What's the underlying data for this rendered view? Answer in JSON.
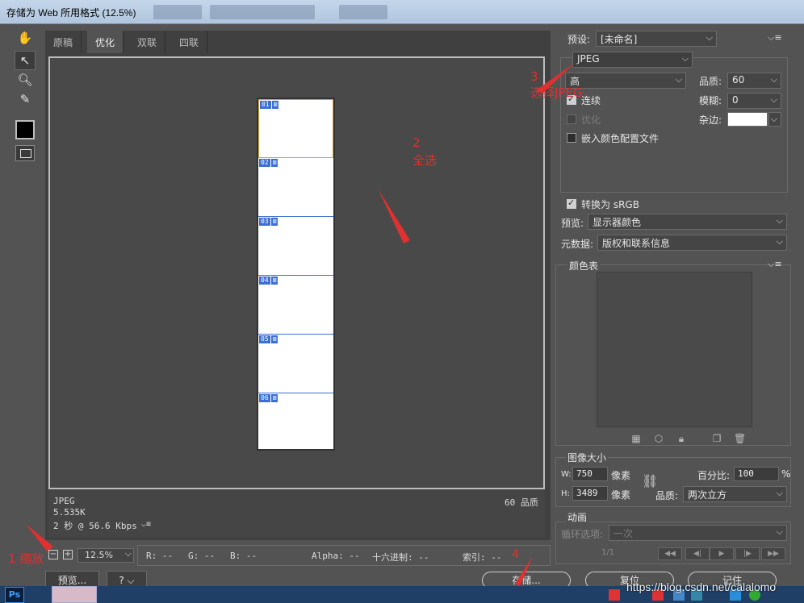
{
  "window": {
    "title": "存储为 Web 所用格式 (12.5%)"
  },
  "tabs": [
    "原稿",
    "优化",
    "双联",
    "四联"
  ],
  "active_tab": "优化",
  "slices": [
    "01",
    "02",
    "03",
    "04",
    "05",
    "06"
  ],
  "image_info": {
    "format": "JPEG",
    "size": "5.535K",
    "time": "2 秒 @ 56.6 Kbps",
    "quality": "60 品质"
  },
  "zoom": {
    "minus": "−",
    "plus": "+",
    "value": "12.5%"
  },
  "readout": {
    "r": "R: --",
    "g": "G: --",
    "b": "B: --",
    "alpha": "Alpha: --",
    "hex": "十六进制: --",
    "index": "索引: --"
  },
  "buttons": {
    "preview": "预览...",
    "help": "?",
    "save": "存储...",
    "reset": "复位",
    "remember": "记住"
  },
  "settings": {
    "preset_label": "预设:",
    "preset_value": "[未命名]",
    "format_value": "JPEG",
    "compression_value": "高",
    "quality_label": "品质:",
    "quality_value": "60",
    "blur_label": "模糊:",
    "blur_value": "0",
    "matte_label": "杂边:",
    "progressive_label": "连续",
    "progressive_checked": true,
    "optimized_label": "优化",
    "optimized_checked": false,
    "embed_profile_label": "嵌入颜色配置文件",
    "embed_profile_checked": false,
    "convert_srgb_label": "转换为 sRGB",
    "convert_srgb_checked": true,
    "preview_label": "预览:",
    "preview_value": "显示器颜色",
    "metadata_label": "元数据:",
    "metadata_value": "版权和联系信息"
  },
  "color_table": {
    "label": "颜色表"
  },
  "image_size": {
    "label": "图像大小",
    "w_label": "W:",
    "w_value": "750",
    "h_label": "H:",
    "h_value": "3489",
    "unit": "像素",
    "percent_label": "百分比:",
    "percent_value": "100",
    "percent_unit": "%",
    "quality_label": "品质:",
    "quality_value": "两次立方"
  },
  "animation": {
    "label": "动画",
    "loop_label": "循环选项:",
    "loop_value": "一次",
    "frame": "1/1"
  },
  "annotations": {
    "step1": "1  缩放",
    "step2_num": "2",
    "step2_text": "全选",
    "step3_num": "3",
    "step3_text": "选择JPEG",
    "step4": "4"
  },
  "taskbar": {
    "ps_label": "Ps"
  },
  "watermark": "https://blog.csdn.net/calalomo",
  "colors": {
    "accent_red": "#e03030",
    "slice_blue": "#3b6fd6",
    "panel_bg": "#535353"
  }
}
